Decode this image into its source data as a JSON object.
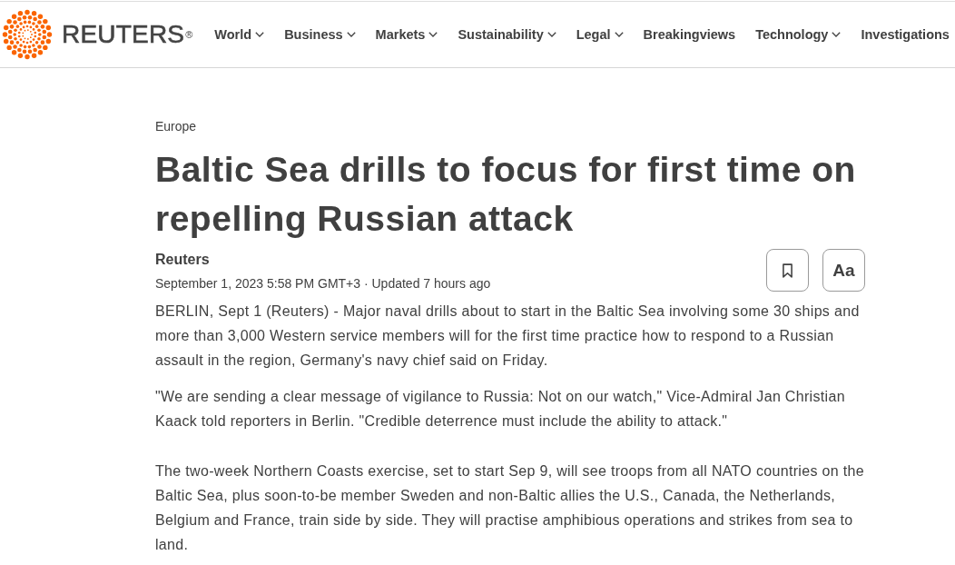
{
  "header": {
    "logo": {
      "wordmark": "REUTERS",
      "mark": "®"
    },
    "nav": [
      {
        "label": "World",
        "dropdown": true
      },
      {
        "label": "Business",
        "dropdown": true
      },
      {
        "label": "Markets",
        "dropdown": true
      },
      {
        "label": "Sustainability",
        "dropdown": true
      },
      {
        "label": "Legal",
        "dropdown": true
      },
      {
        "label": "Breakingviews",
        "dropdown": false
      },
      {
        "label": "Technology",
        "dropdown": true
      },
      {
        "label": "Investigations",
        "dropdown": false
      }
    ]
  },
  "article": {
    "section": "Europe",
    "headline": "Baltic Sea drills to focus for first time on repelling Russian attack",
    "byline": "Reuters",
    "dateline": "September 1, 2023 5:58 PM GMT+3 · Updated 7 hours ago",
    "actions": [
      {
        "kind": "bookmark"
      },
      {
        "kind": "text-size",
        "label": "Aa"
      }
    ],
    "paragraphs": [
      "BERLIN, Sept 1 (Reuters) - Major naval drills about to start in the Baltic Sea involving some 30 ships and more than 3,000 Western service members will for the first time practice how to respond to a Russian assault in the region, Germany's navy chief said on Friday.",
      "\"We are sending a clear message of vigilance to Russia: Not on our watch,\" Vice-Admiral Jan Christian Kaack told reporters in Berlin. \"Credible deterrence must include the ability to attack.\"",
      "The two-week Northern Coasts exercise, set to start Sep 9, will see troops from all NATO countries on the Baltic Sea, plus soon-to-be member Sweden and non-Baltic allies the U.S., Canada, the Netherlands, Belgium and France, train side by side. They will practise amphibious operations and strikes from sea to land."
    ]
  }
}
